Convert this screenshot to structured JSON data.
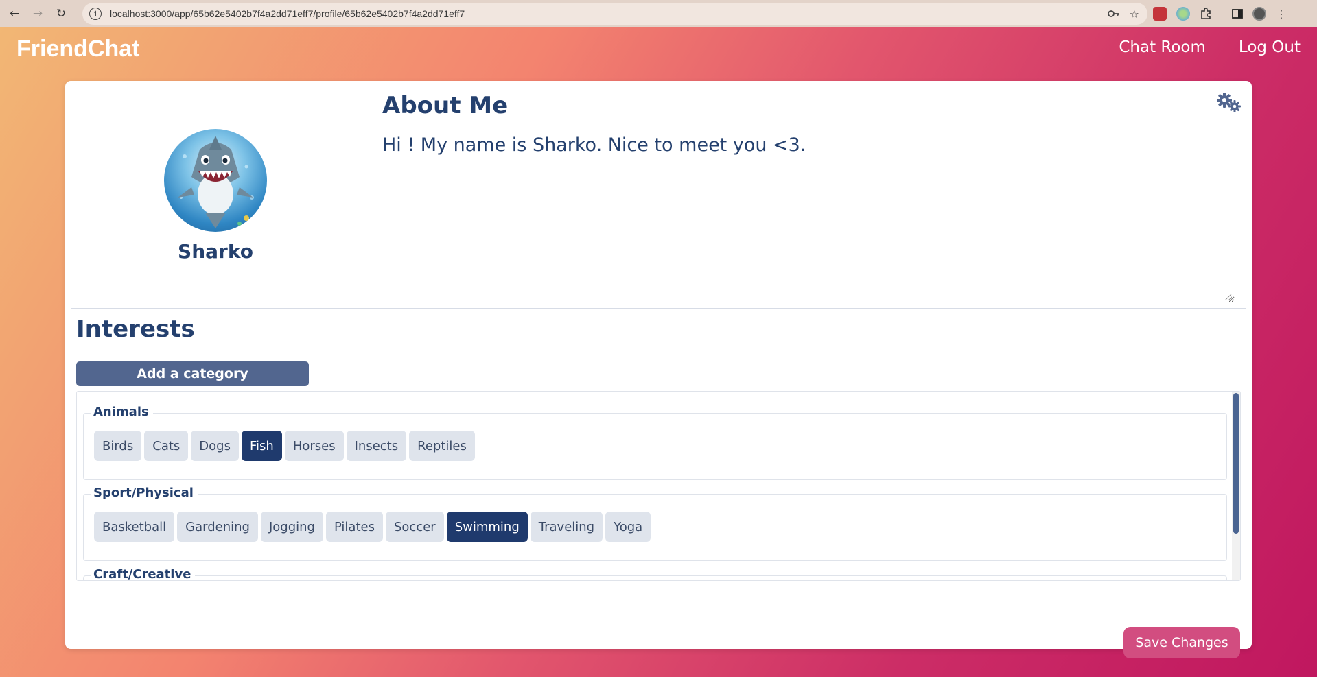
{
  "browser": {
    "url": "localhost:3000/app/65b62e5402b7f4a2dd71eff7/profile/65b62e5402b7f4a2dd71eff7"
  },
  "header": {
    "brand": "FriendChat",
    "nav": {
      "chat_room": "Chat Room",
      "log_out": "Log Out"
    }
  },
  "profile": {
    "username": "Sharko",
    "about_title": "About Me",
    "about_text": "Hi ! My name is Sharko. Nice to meet you <3."
  },
  "interests": {
    "title": "Interests",
    "add_category_label": "Add a category",
    "categories": [
      {
        "name": "Animals",
        "items": [
          {
            "label": "Birds",
            "selected": false
          },
          {
            "label": "Cats",
            "selected": false
          },
          {
            "label": "Dogs",
            "selected": false
          },
          {
            "label": "Fish",
            "selected": true
          },
          {
            "label": "Horses",
            "selected": false
          },
          {
            "label": "Insects",
            "selected": false
          },
          {
            "label": "Reptiles",
            "selected": false
          }
        ]
      },
      {
        "name": "Sport/Physical",
        "items": [
          {
            "label": "Basketball",
            "selected": false
          },
          {
            "label": "Gardening",
            "selected": false
          },
          {
            "label": "Jogging",
            "selected": false
          },
          {
            "label": "Pilates",
            "selected": false
          },
          {
            "label": "Soccer",
            "selected": false
          },
          {
            "label": "Swimming",
            "selected": true
          },
          {
            "label": "Traveling",
            "selected": false
          },
          {
            "label": "Yoga",
            "selected": false
          }
        ]
      },
      {
        "name": "Craft/Creative",
        "items": []
      }
    ]
  },
  "actions": {
    "save_label": "Save Changes"
  },
  "colors": {
    "primary_text": "#24406e",
    "chip_selected": "#1f3a6d",
    "chip_default": "#dfe4ec",
    "add_button": "#52668f",
    "save_button": "#d24d80",
    "gradient_start": "#f2b774",
    "gradient_end": "#c0175f"
  }
}
